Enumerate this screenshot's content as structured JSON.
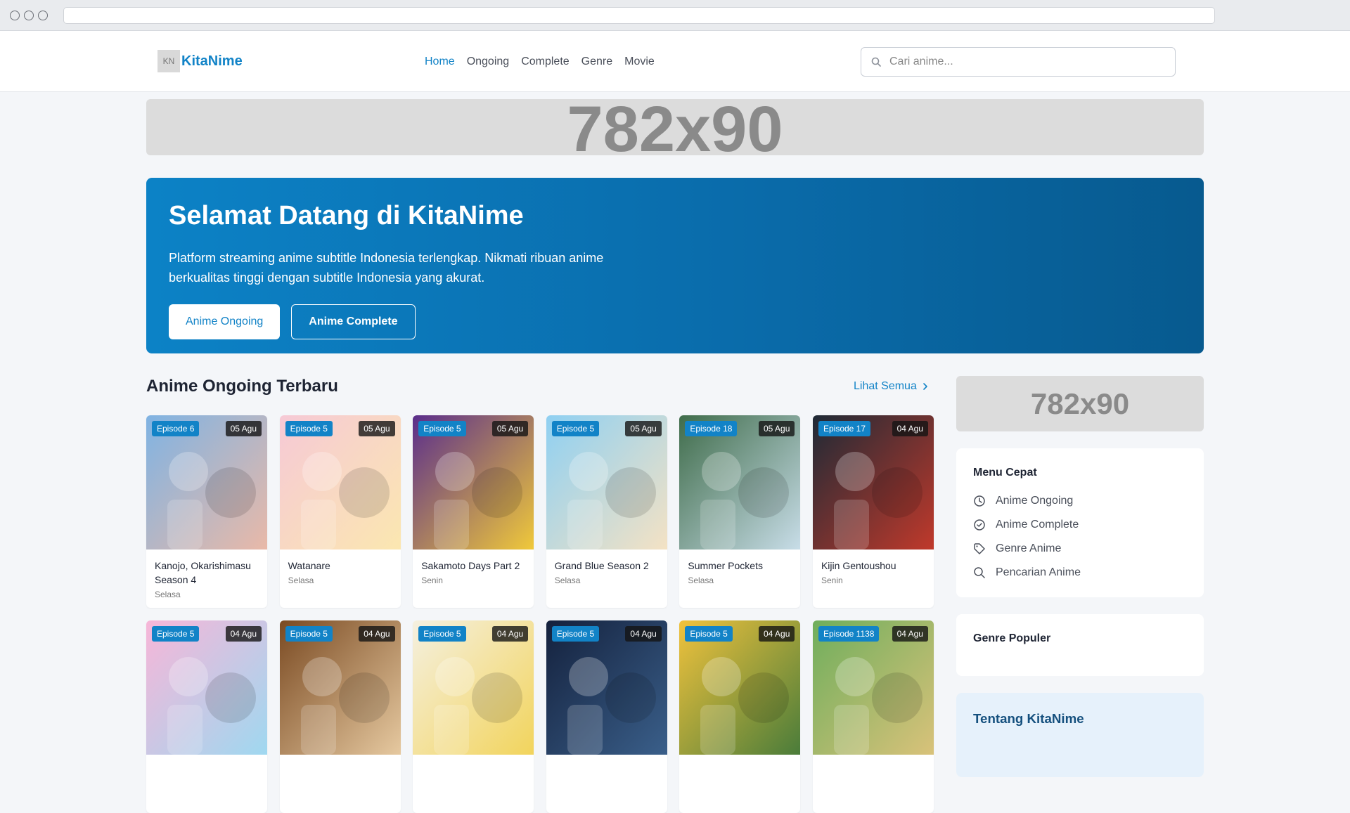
{
  "header": {
    "logo_badge": "KN",
    "logo_text": "KitaNime",
    "nav": [
      {
        "label": "Home",
        "active": true
      },
      {
        "label": "Ongoing",
        "active": false
      },
      {
        "label": "Complete",
        "active": false
      },
      {
        "label": "Genre",
        "active": false
      },
      {
        "label": "Movie",
        "active": false
      }
    ],
    "search_placeholder": "Cari anime..."
  },
  "ads": {
    "top": "782x90",
    "side": "782x90"
  },
  "hero": {
    "title": "Selamat Datang di KitaNime",
    "subtitle": "Platform streaming anime subtitle Indonesia terlengkap. Nikmati ribuan anime berkualitas tinggi dengan subtitle Indonesia yang akurat.",
    "btn_ongoing": "Anime Ongoing",
    "btn_complete": "Anime Complete"
  },
  "section": {
    "title": "Anime Ongoing Terbaru",
    "see_all": "Lihat Semua"
  },
  "cards": [
    {
      "episode": "Episode 6",
      "date": "05 Agu",
      "title": "Kanojo, Okarishimasu Season 4",
      "day": "Selasa",
      "c1": "#7fb3e3",
      "c2": "#e9b9a8"
    },
    {
      "episode": "Episode 5",
      "date": "05 Agu",
      "title": "Watanare",
      "day": "Selasa",
      "c1": "#f6c9d6",
      "c2": "#fbe7b0"
    },
    {
      "episode": "Episode 5",
      "date": "05 Agu",
      "title": "Sakamoto Days Part 2",
      "day": "Senin",
      "c1": "#5a2d8c",
      "c2": "#f0c93a"
    },
    {
      "episode": "Episode 5",
      "date": "05 Agu",
      "title": "Grand Blue Season 2",
      "day": "Selasa",
      "c1": "#8fd0f2",
      "c2": "#f4e2c4"
    },
    {
      "episode": "Episode 18",
      "date": "05 Agu",
      "title": "Summer Pockets",
      "day": "Selasa",
      "c1": "#3f6c4a",
      "c2": "#c8dde8"
    },
    {
      "episode": "Episode 17",
      "date": "04 Agu",
      "title": "Kijin Gentoushou",
      "day": "Senin",
      "c1": "#1e2a36",
      "c2": "#c0392b"
    },
    {
      "episode": "Episode 5",
      "date": "04 Agu",
      "title": "",
      "day": "",
      "c1": "#f7b6d8",
      "c2": "#9fd8f0"
    },
    {
      "episode": "Episode 5",
      "date": "04 Agu",
      "title": "",
      "day": "",
      "c1": "#7a4a22",
      "c2": "#e6c9a0"
    },
    {
      "episode": "Episode 5",
      "date": "04 Agu",
      "title": "",
      "day": "",
      "c1": "#f5f0e0",
      "c2": "#f2d45c"
    },
    {
      "episode": "Episode 5",
      "date": "04 Agu",
      "title": "",
      "day": "",
      "c1": "#14213d",
      "c2": "#3a5f8a"
    },
    {
      "episode": "Episode 5",
      "date": "04 Agu",
      "title": "",
      "day": "",
      "c1": "#f0c23c",
      "c2": "#4a7c3a"
    },
    {
      "episode": "Episode 1138",
      "date": "04 Agu",
      "title": "",
      "day": "",
      "c1": "#6fae5c",
      "c2": "#d9c27a"
    }
  ],
  "sidebar": {
    "quick_menu_title": "Menu Cepat",
    "quick_menu": [
      {
        "label": "Anime Ongoing",
        "icon": "clock-icon"
      },
      {
        "label": "Anime Complete",
        "icon": "check-circle-icon"
      },
      {
        "label": "Genre Anime",
        "icon": "tag-icon"
      },
      {
        "label": "Pencarian Anime",
        "icon": "search-icon"
      }
    ],
    "genre_title": "Genre Populer",
    "about_title": "Tentang KitaNime"
  },
  "colors": {
    "accent": "#1283c7",
    "hero_start": "#0c82c6",
    "hero_end": "#075a8f"
  }
}
